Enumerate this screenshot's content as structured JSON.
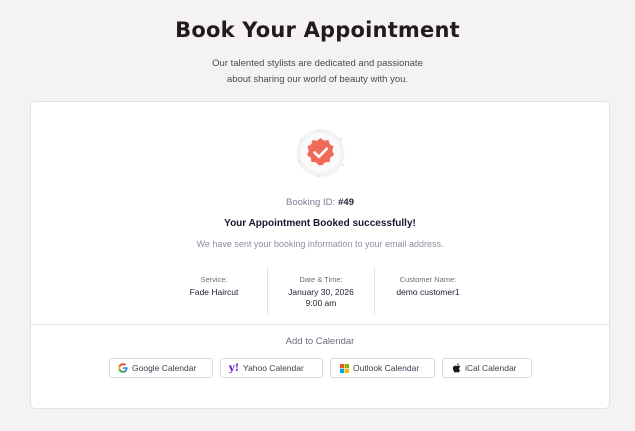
{
  "header": {
    "title": "Book Your Appointment",
    "subtitle_line1": "Our talented stylists are dedicated and passionate",
    "subtitle_line2": "about sharing our world of beauty with you."
  },
  "confirmation": {
    "badge_icon": "check-badge-icon",
    "booking_id_label": "Booking ID:",
    "booking_id_value": "#49",
    "success_message": "Your Appointment Booked successfully!",
    "info_message": "We have sent your booking information to your email address."
  },
  "details": {
    "service_label": "Service:",
    "service_value": "Fade Haircut",
    "datetime_label": "Date & Time:",
    "date_value": "January 30, 2026",
    "time_value": "9:00 am",
    "customer_label": "Customer Name:",
    "customer_value": "demo customer1"
  },
  "calendar": {
    "heading": "Add to Calendar",
    "google_label": "Google Calendar",
    "yahoo_label": "Yahoo Calendar",
    "outlook_label": "Outlook Calendar",
    "ical_label": "iCal Calendar"
  },
  "colors": {
    "accent": "#f06a5a",
    "title": "#241a1a",
    "background": "#f4f2f2"
  }
}
